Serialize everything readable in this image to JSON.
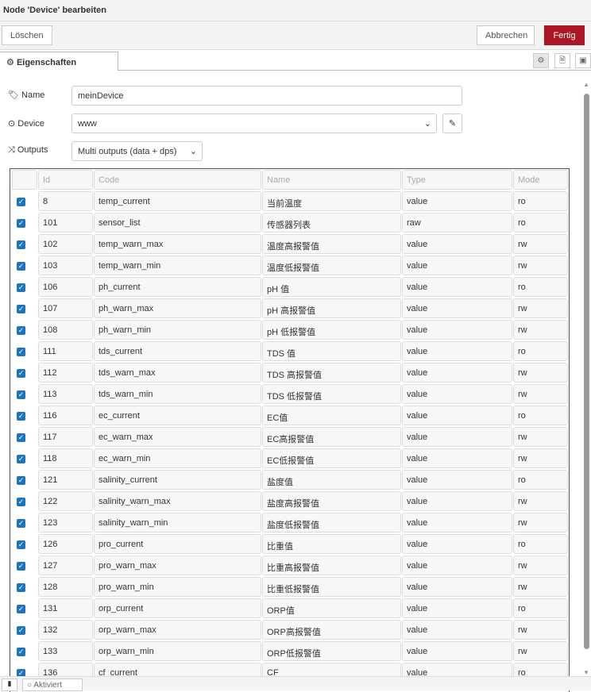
{
  "title": "Node 'Device' bearbeiten",
  "toolbar": {
    "delete": "Löschen",
    "cancel": "Abbrechen",
    "done": "Fertig"
  },
  "tab": {
    "label": "Eigenschaften"
  },
  "form": {
    "name_label": "Name",
    "name_value": "meinDevice",
    "device_label": "Device",
    "device_value": "www",
    "outputs_label": "Outputs",
    "outputs_value": "Multi outputs (data + dps)"
  },
  "table": {
    "headers": {
      "id": "Id",
      "code": "Code",
      "name": "Name",
      "type": "Type",
      "mode": "Mode"
    },
    "rows": [
      {
        "id": "8",
        "code": "temp_current",
        "name": "当前温度",
        "type": "value",
        "mode": "ro"
      },
      {
        "id": "101",
        "code": "sensor_list",
        "name": "传感器列表",
        "type": "raw",
        "mode": "ro"
      },
      {
        "id": "102",
        "code": "temp_warn_max",
        "name": "温度高报警值",
        "type": "value",
        "mode": "rw"
      },
      {
        "id": "103",
        "code": "temp_warn_min",
        "name": "温度低报警值",
        "type": "value",
        "mode": "rw"
      },
      {
        "id": "106",
        "code": "ph_current",
        "name": "pH 值",
        "type": "value",
        "mode": "ro"
      },
      {
        "id": "107",
        "code": "ph_warn_max",
        "name": "pH 高报警值",
        "type": "value",
        "mode": "rw"
      },
      {
        "id": "108",
        "code": "ph_warn_min",
        "name": "pH 低报警值",
        "type": "value",
        "mode": "rw"
      },
      {
        "id": "111",
        "code": "tds_current",
        "name": "TDS 值",
        "type": "value",
        "mode": "ro"
      },
      {
        "id": "112",
        "code": "tds_warn_max",
        "name": "TDS 高报警值",
        "type": "value",
        "mode": "rw"
      },
      {
        "id": "113",
        "code": "tds_warn_min",
        "name": "TDS 低报警值",
        "type": "value",
        "mode": "rw"
      },
      {
        "id": "116",
        "code": "ec_current",
        "name": "EC值",
        "type": "value",
        "mode": "ro"
      },
      {
        "id": "117",
        "code": "ec_warn_max",
        "name": "EC高报警值",
        "type": "value",
        "mode": "rw"
      },
      {
        "id": "118",
        "code": "ec_warn_min",
        "name": "EC低报警值",
        "type": "value",
        "mode": "rw"
      },
      {
        "id": "121",
        "code": "salinity_current",
        "name": "盐度值",
        "type": "value",
        "mode": "ro"
      },
      {
        "id": "122",
        "code": "salinity_warn_max",
        "name": "盐度高报警值",
        "type": "value",
        "mode": "rw"
      },
      {
        "id": "123",
        "code": "salinity_warn_min",
        "name": "盐度低报警值",
        "type": "value",
        "mode": "rw"
      },
      {
        "id": "126",
        "code": "pro_current",
        "name": "比重值",
        "type": "value",
        "mode": "ro"
      },
      {
        "id": "127",
        "code": "pro_warn_max",
        "name": "比重高报警值",
        "type": "value",
        "mode": "rw"
      },
      {
        "id": "128",
        "code": "pro_warn_min",
        "name": "比重低报警值",
        "type": "value",
        "mode": "rw"
      },
      {
        "id": "131",
        "code": "orp_current",
        "name": "ORP值",
        "type": "value",
        "mode": "ro"
      },
      {
        "id": "132",
        "code": "orp_warn_max",
        "name": "ORP高报警值",
        "type": "value",
        "mode": "rw"
      },
      {
        "id": "133",
        "code": "orp_warn_min",
        "name": "ORP低报警值",
        "type": "value",
        "mode": "rw"
      },
      {
        "id": "136",
        "code": "cf_current",
        "name": "CF",
        "type": "value",
        "mode": "ro"
      }
    ]
  },
  "footer": {
    "enabled": "Aktiviert"
  }
}
